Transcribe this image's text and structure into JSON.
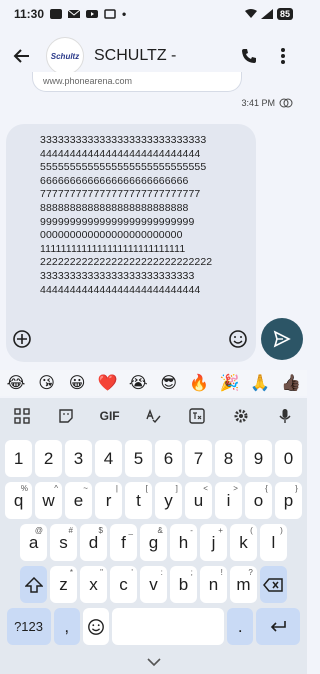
{
  "status": {
    "time": "11:30",
    "battery": "85"
  },
  "header": {
    "contact_name": "SCHULTZ -",
    "avatar_text": "Schultz"
  },
  "link_preview": {
    "domain": "www.phonearena.com"
  },
  "message": {
    "time": "3:41 PM",
    "lines": [
      "3333333333333333333333333333",
      "444444444444444444444444444",
      "5555555555555555555555555555",
      "6666666666666666666666666",
      "777777777777777777777777777",
      "8888888888888888888888888",
      "99999999999999999999999999",
      "000000000000000000000000",
      "1111111111111111111111111111",
      "22222222222222222222222222222",
      "33333333333333333333333333",
      "444444444444444444444444444"
    ]
  },
  "emoji_suggestions": [
    "😂",
    "😘",
    "😀",
    "❤️",
    "😭",
    "😎",
    "🔥",
    "🎉",
    "🙏",
    "👍🏿"
  ],
  "keyboard": {
    "toolbar": {
      "gif": "GIF"
    },
    "row1": [
      "1",
      "2",
      "3",
      "4",
      "5",
      "6",
      "7",
      "8",
      "9",
      "0"
    ],
    "row2": [
      {
        "k": "q",
        "h": "%"
      },
      {
        "k": "w",
        "h": "^"
      },
      {
        "k": "e",
        "h": "~"
      },
      {
        "k": "r",
        "h": "|"
      },
      {
        "k": "t",
        "h": "["
      },
      {
        "k": "y",
        "h": "]"
      },
      {
        "k": "u",
        "h": "<"
      },
      {
        "k": "i",
        "h": ">"
      },
      {
        "k": "o",
        "h": "{"
      },
      {
        "k": "p",
        "h": "}"
      }
    ],
    "row3": [
      {
        "k": "a",
        "h": "@"
      },
      {
        "k": "s",
        "h": "#"
      },
      {
        "k": "d",
        "h": "$"
      },
      {
        "k": "f",
        "h": "_"
      },
      {
        "k": "g",
        "h": "&"
      },
      {
        "k": "h",
        "h": "-"
      },
      {
        "k": "j",
        "h": "+"
      },
      {
        "k": "k",
        "h": "("
      },
      {
        "k": "l",
        "h": ")"
      }
    ],
    "row4": [
      {
        "k": "z",
        "h": "*"
      },
      {
        "k": "x",
        "h": "\""
      },
      {
        "k": "c",
        "h": "'"
      },
      {
        "k": "v",
        "h": ":"
      },
      {
        "k": "b",
        "h": ";"
      },
      {
        "k": "n",
        "h": "!"
      },
      {
        "k": "m",
        "h": "?"
      }
    ],
    "symbols_key": "?123",
    "comma_key": ",",
    "period_key": "."
  }
}
